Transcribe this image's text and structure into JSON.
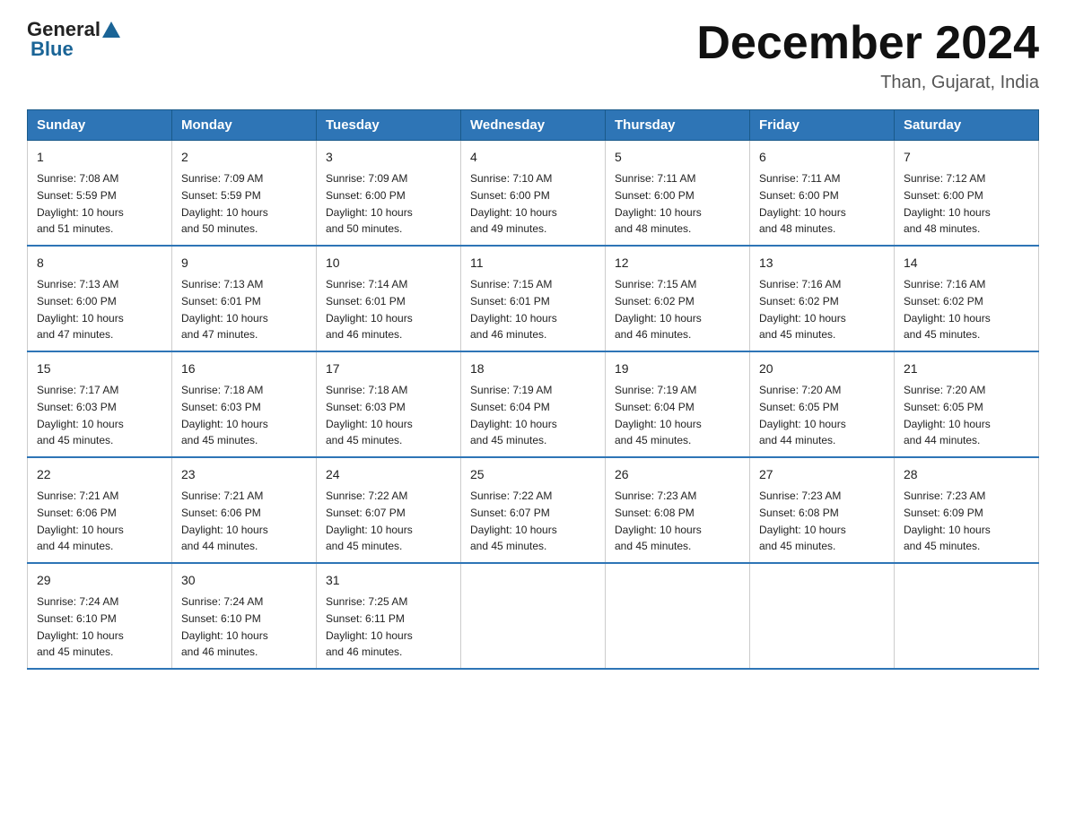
{
  "logo": {
    "general": "General",
    "blue": "Blue"
  },
  "header": {
    "month": "December 2024",
    "location": "Than, Gujarat, India"
  },
  "days_of_week": [
    "Sunday",
    "Monday",
    "Tuesday",
    "Wednesday",
    "Thursday",
    "Friday",
    "Saturday"
  ],
  "weeks": [
    [
      {
        "num": "1",
        "sunrise": "7:08 AM",
        "sunset": "5:59 PM",
        "daylight": "10 hours and 51 minutes."
      },
      {
        "num": "2",
        "sunrise": "7:09 AM",
        "sunset": "5:59 PM",
        "daylight": "10 hours and 50 minutes."
      },
      {
        "num": "3",
        "sunrise": "7:09 AM",
        "sunset": "6:00 PM",
        "daylight": "10 hours and 50 minutes."
      },
      {
        "num": "4",
        "sunrise": "7:10 AM",
        "sunset": "6:00 PM",
        "daylight": "10 hours and 49 minutes."
      },
      {
        "num": "5",
        "sunrise": "7:11 AM",
        "sunset": "6:00 PM",
        "daylight": "10 hours and 48 minutes."
      },
      {
        "num": "6",
        "sunrise": "7:11 AM",
        "sunset": "6:00 PM",
        "daylight": "10 hours and 48 minutes."
      },
      {
        "num": "7",
        "sunrise": "7:12 AM",
        "sunset": "6:00 PM",
        "daylight": "10 hours and 48 minutes."
      }
    ],
    [
      {
        "num": "8",
        "sunrise": "7:13 AM",
        "sunset": "6:00 PM",
        "daylight": "10 hours and 47 minutes."
      },
      {
        "num": "9",
        "sunrise": "7:13 AM",
        "sunset": "6:01 PM",
        "daylight": "10 hours and 47 minutes."
      },
      {
        "num": "10",
        "sunrise": "7:14 AM",
        "sunset": "6:01 PM",
        "daylight": "10 hours and 46 minutes."
      },
      {
        "num": "11",
        "sunrise": "7:15 AM",
        "sunset": "6:01 PM",
        "daylight": "10 hours and 46 minutes."
      },
      {
        "num": "12",
        "sunrise": "7:15 AM",
        "sunset": "6:02 PM",
        "daylight": "10 hours and 46 minutes."
      },
      {
        "num": "13",
        "sunrise": "7:16 AM",
        "sunset": "6:02 PM",
        "daylight": "10 hours and 45 minutes."
      },
      {
        "num": "14",
        "sunrise": "7:16 AM",
        "sunset": "6:02 PM",
        "daylight": "10 hours and 45 minutes."
      }
    ],
    [
      {
        "num": "15",
        "sunrise": "7:17 AM",
        "sunset": "6:03 PM",
        "daylight": "10 hours and 45 minutes."
      },
      {
        "num": "16",
        "sunrise": "7:18 AM",
        "sunset": "6:03 PM",
        "daylight": "10 hours and 45 minutes."
      },
      {
        "num": "17",
        "sunrise": "7:18 AM",
        "sunset": "6:03 PM",
        "daylight": "10 hours and 45 minutes."
      },
      {
        "num": "18",
        "sunrise": "7:19 AM",
        "sunset": "6:04 PM",
        "daylight": "10 hours and 45 minutes."
      },
      {
        "num": "19",
        "sunrise": "7:19 AM",
        "sunset": "6:04 PM",
        "daylight": "10 hours and 45 minutes."
      },
      {
        "num": "20",
        "sunrise": "7:20 AM",
        "sunset": "6:05 PM",
        "daylight": "10 hours and 44 minutes."
      },
      {
        "num": "21",
        "sunrise": "7:20 AM",
        "sunset": "6:05 PM",
        "daylight": "10 hours and 44 minutes."
      }
    ],
    [
      {
        "num": "22",
        "sunrise": "7:21 AM",
        "sunset": "6:06 PM",
        "daylight": "10 hours and 44 minutes."
      },
      {
        "num": "23",
        "sunrise": "7:21 AM",
        "sunset": "6:06 PM",
        "daylight": "10 hours and 44 minutes."
      },
      {
        "num": "24",
        "sunrise": "7:22 AM",
        "sunset": "6:07 PM",
        "daylight": "10 hours and 45 minutes."
      },
      {
        "num": "25",
        "sunrise": "7:22 AM",
        "sunset": "6:07 PM",
        "daylight": "10 hours and 45 minutes."
      },
      {
        "num": "26",
        "sunrise": "7:23 AM",
        "sunset": "6:08 PM",
        "daylight": "10 hours and 45 minutes."
      },
      {
        "num": "27",
        "sunrise": "7:23 AM",
        "sunset": "6:08 PM",
        "daylight": "10 hours and 45 minutes."
      },
      {
        "num": "28",
        "sunrise": "7:23 AM",
        "sunset": "6:09 PM",
        "daylight": "10 hours and 45 minutes."
      }
    ],
    [
      {
        "num": "29",
        "sunrise": "7:24 AM",
        "sunset": "6:10 PM",
        "daylight": "10 hours and 45 minutes."
      },
      {
        "num": "30",
        "sunrise": "7:24 AM",
        "sunset": "6:10 PM",
        "daylight": "10 hours and 46 minutes."
      },
      {
        "num": "31",
        "sunrise": "7:25 AM",
        "sunset": "6:11 PM",
        "daylight": "10 hours and 46 minutes."
      },
      null,
      null,
      null,
      null
    ]
  ],
  "labels": {
    "sunrise": "Sunrise:",
    "sunset": "Sunset:",
    "daylight": "Daylight:"
  }
}
